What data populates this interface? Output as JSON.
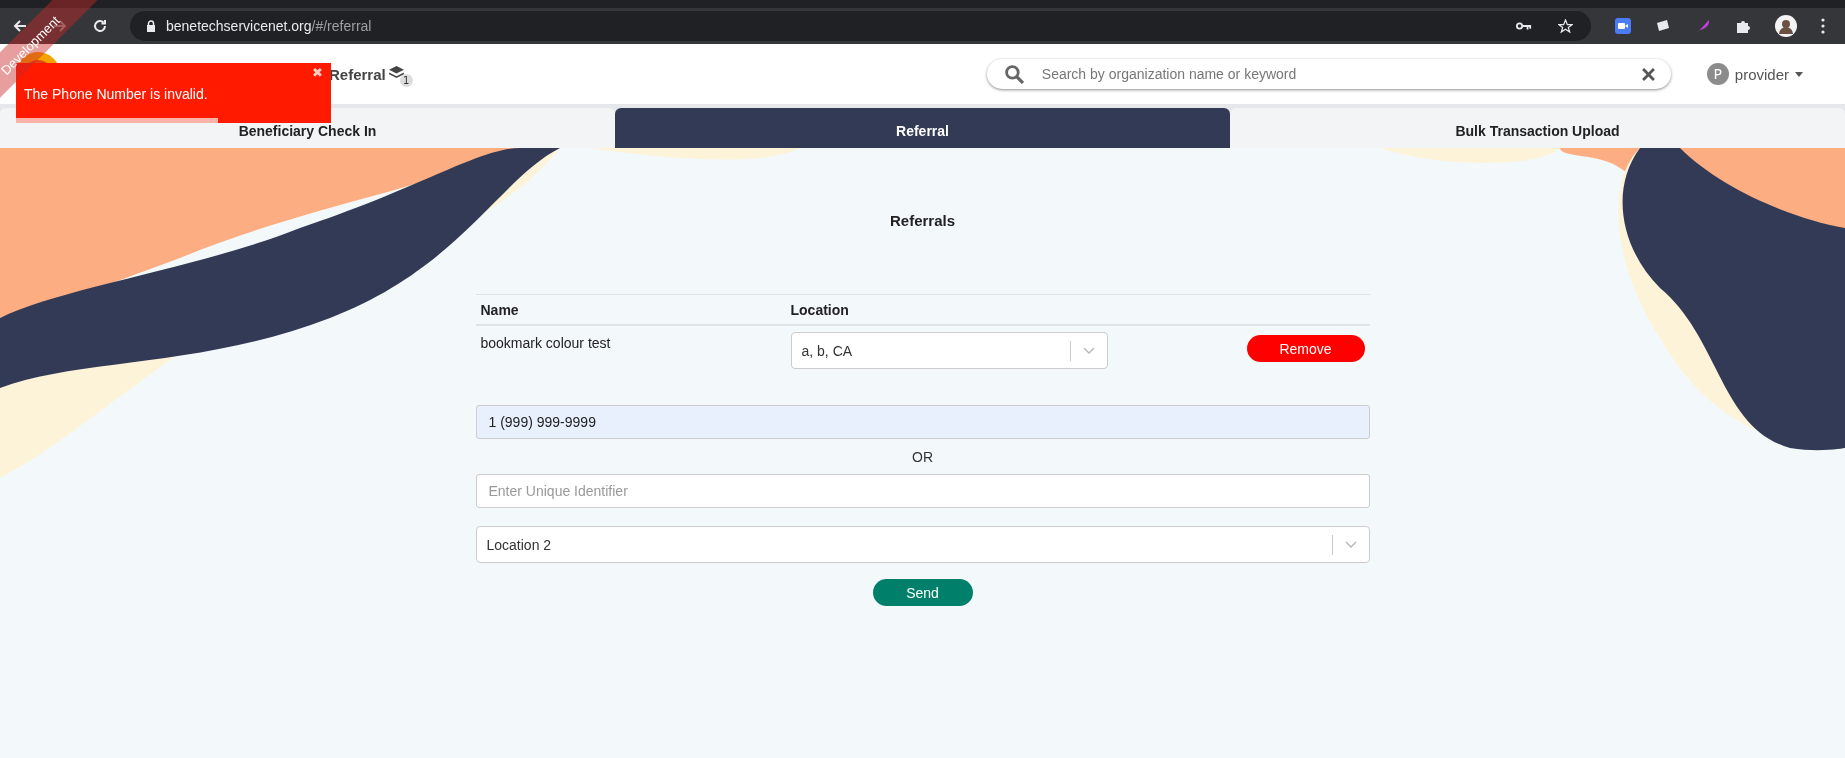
{
  "browser": {
    "url_host": "benetechservicenet.org",
    "url_path": "/#/referral"
  },
  "header": {
    "nav_link": "Referral",
    "nav_badge": "1",
    "search": {
      "placeholder": "Search by organization name or keyword"
    },
    "user": {
      "avatar_letter": "P",
      "name": "provider"
    }
  },
  "toast": {
    "message": "The Phone Number is invalid.",
    "close": "✖",
    "level": 0.64
  },
  "ribbon": "Development",
  "tabs": [
    {
      "label": "Beneficiary Check In",
      "selected": false
    },
    {
      "label": "Referral",
      "selected": true
    },
    {
      "label": "Bulk Transaction Upload",
      "selected": false
    }
  ],
  "page_title": "Referrals",
  "table": {
    "columns": [
      "Name",
      "Location"
    ],
    "rows": [
      {
        "name": "bookmark colour test",
        "location": "a, b, CA",
        "action": "Remove"
      }
    ]
  },
  "form": {
    "phone": {
      "value": "1 (999) 999-9999"
    },
    "separator": "OR",
    "identifier": {
      "placeholder": "Enter Unique Identifier"
    },
    "location": {
      "value": "Location 2"
    },
    "submit": "Send"
  }
}
